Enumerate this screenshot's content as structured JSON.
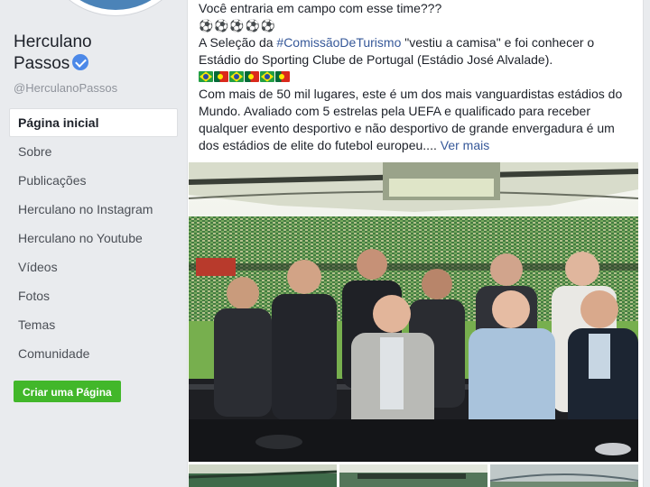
{
  "profile": {
    "name_line1": "Herculano",
    "name_line2": "Passos",
    "handle": "@HerculanoPassos",
    "verified": true
  },
  "nav": {
    "items": [
      {
        "label": "Página inicial",
        "active": true
      },
      {
        "label": "Sobre"
      },
      {
        "label": "Publicações"
      },
      {
        "label": "Herculano no Instagram"
      },
      {
        "label": "Herculano no Youtube"
      },
      {
        "label": "Vídeos"
      },
      {
        "label": "Fotos"
      },
      {
        "label": "Temas"
      },
      {
        "label": "Comunidade"
      }
    ]
  },
  "create_page_button": "Criar uma Página",
  "post": {
    "line1": "Você entraria em campo com esse time???",
    "balls": "⚽⚽⚽⚽⚽",
    "para1_prefix": "A Seleção da ",
    "hashtag": "#ComissãoDeTurismo",
    "para1_suffix": " \"vestiu a camisa\" e foi conhecer o Estádio do Sporting Clube de Portugal (Estádio José Alvalade).",
    "para2": "Com mais de 50 mil lugares, este é um dos mais vanguardistas estádios do Mundo. Avaliado com 5 estrelas pela UEFA e qualificado para receber qualquer evento desportivo e não desportivo de grande envergadura é um dos estádios de elite do futebol europeu....",
    "see_more": "Ver mais"
  },
  "colors": {
    "background": "#e9ebee",
    "link": "#365899",
    "verified": "#4b88e8",
    "create_button": "#42b72a"
  }
}
